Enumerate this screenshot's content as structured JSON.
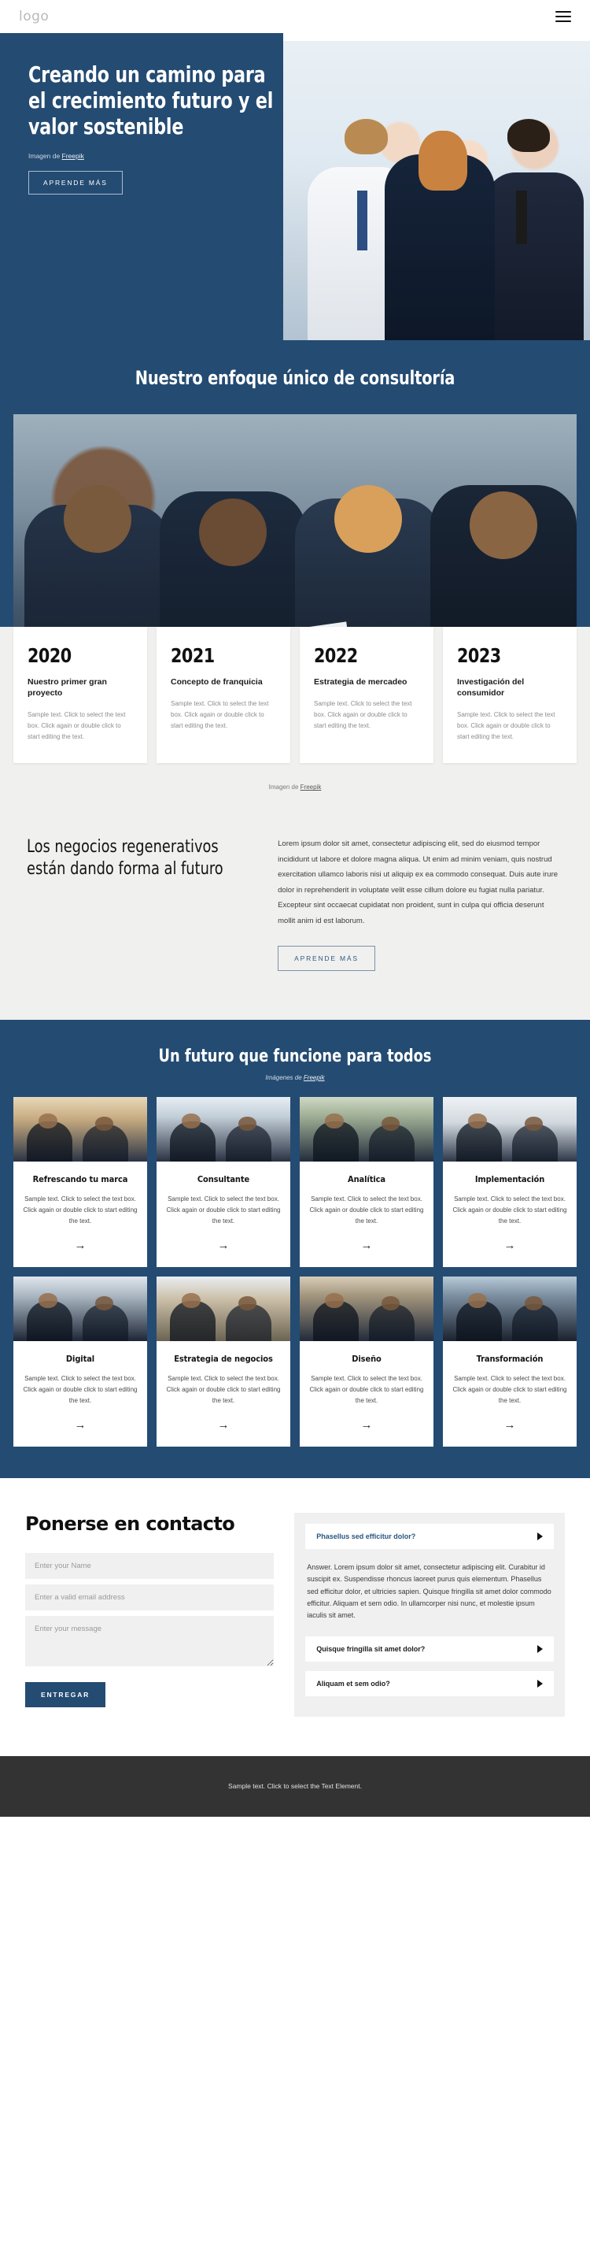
{
  "header": {
    "logo": "logo",
    "menu_icon": "hamburger-menu"
  },
  "hero": {
    "title": "Creando un camino para el crecimiento futuro y el valor sostenible",
    "credit_prefix": "Imagen de ",
    "credit_link": "Freepik",
    "cta": "APRENDE MÁS"
  },
  "approach": {
    "title": "Nuestro enfoque único de consultoría"
  },
  "timeline": {
    "cards": [
      {
        "year": "2020",
        "head": "Nuestro primer gran proyecto",
        "body": "Sample text. Click to select the text box. Click again or double click to start editing the text."
      },
      {
        "year": "2021",
        "head": "Concepto de franquicia",
        "body": "Sample text. Click to select the text box. Click again or double click to start editing the text."
      },
      {
        "year": "2022",
        "head": "Estrategia de mercadeo",
        "body": "Sample text. Click to select the text box. Click again or double click to start editing the text."
      },
      {
        "year": "2023",
        "head": "Investigación del consumidor",
        "body": "Sample text. Click to select the text box. Click again or double click to start editing the text."
      }
    ],
    "credit_prefix": "Imagen de ",
    "credit_link": "Freepik"
  },
  "regen": {
    "title": "Los negocios regenerativos están dando forma al futuro",
    "body": "Lorem ipsum dolor sit amet, consectetur adipiscing elit, sed do eiusmod tempor incididunt ut labore et dolore magna aliqua. Ut enim ad minim veniam, quis nostrud exercitation ullamco laboris nisi ut aliquip ex ea commodo consequat. Duis aute irure dolor in reprehenderit in voluptate velit esse cillum dolore eu fugiat nulla pariatur. Excepteur sint occaecat cupidatat non proident, sunt in culpa qui officia deserunt mollit anim id est laborum.",
    "cta": "APRENDE MÁS"
  },
  "services": {
    "title": "Un futuro que funcione para todos",
    "credit_prefix": "Imágenes de ",
    "credit_link": "Freepik",
    "arrow": "→",
    "cards": [
      {
        "name": "Refrescando tu marca",
        "text": "Sample text. Click to select the text box. Click again or double click to start editing the text."
      },
      {
        "name": "Consultante",
        "text": "Sample text. Click to select the text box. Click again or double click to start editing the text."
      },
      {
        "name": "Analítica",
        "text": "Sample text. Click to select the text box. Click again or double click to start editing the text."
      },
      {
        "name": "Implementación",
        "text": "Sample text. Click to select the text box. Click again or double click to start editing the text."
      },
      {
        "name": "Digital",
        "text": "Sample text. Click to select the text box. Click again or double click to start editing the text."
      },
      {
        "name": "Estrategia de negocios",
        "text": "Sample text. Click to select the text box. Click again or double click to start editing the text."
      },
      {
        "name": "Diseño",
        "text": "Sample text. Click to select the text box. Click again or double click to start editing the text."
      },
      {
        "name": "Transformación",
        "text": "Sample text. Click to select the text box. Click again or double click to start editing the text."
      }
    ]
  },
  "contact": {
    "title": "Ponerse en contacto",
    "name_placeholder": "Enter your Name",
    "email_placeholder": "Enter a valid email address",
    "message_placeholder": "Enter your message",
    "submit": "ENTREGAR",
    "faq": [
      {
        "q": "Phasellus sed efficitur dolor?",
        "a": "Answer. Lorem ipsum dolor sit amet, consectetur adipiscing elit. Curabitur id suscipit ex. Suspendisse rhoncus laoreet purus quis elementum. Phasellus sed efficitur dolor, et ultricies sapien. Quisque fringilla sit amet dolor commodo efficitur. Aliquam et sem odio. In ullamcorper nisi nunc, et molestie ipsum iaculis sit amet."
      },
      {
        "q": "Quisque fringilla sit amet dolor?"
      },
      {
        "q": "Aliquam et sem odio?"
      }
    ]
  },
  "footer": {
    "text": "Sample text. Click to select the Text Element."
  },
  "colors": {
    "brand_blue": "#244b72",
    "light_gray": "#f0f0ef",
    "footer_dark": "#333333"
  }
}
